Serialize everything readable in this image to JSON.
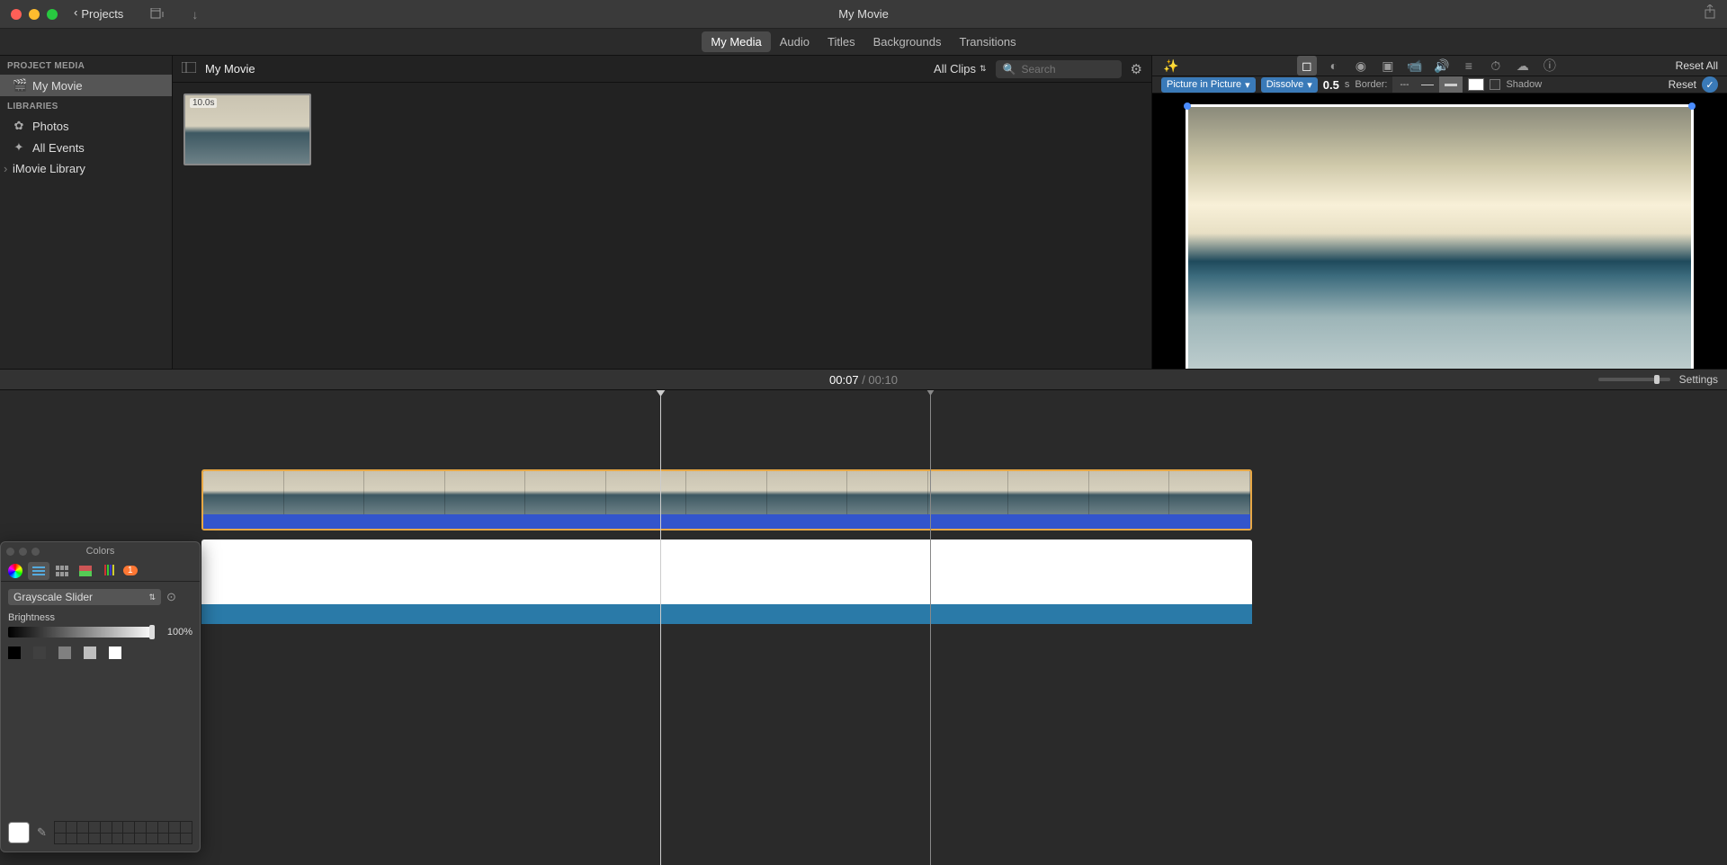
{
  "titlebar": {
    "back_label": "Projects",
    "title": "My Movie"
  },
  "tabs": {
    "my_media": "My Media",
    "audio": "Audio",
    "titles": "Titles",
    "backgrounds": "Backgrounds",
    "transitions": "Transitions"
  },
  "sidebar": {
    "project_media_header": "PROJECT MEDIA",
    "my_movie": "My Movie",
    "libraries_header": "LIBRARIES",
    "photos": "Photos",
    "all_events": "All Events",
    "imovie_library": "iMovie Library"
  },
  "browser": {
    "title": "My Movie",
    "clips_filter": "All Clips",
    "search_placeholder": "Search",
    "clip_duration": "10.0s"
  },
  "viewer": {
    "reset_all": "Reset All",
    "overlay_mode": "Picture in Picture",
    "transition_mode": "Dissolve",
    "duration_value": "0.5",
    "duration_unit": "s",
    "border_label": "Border:",
    "border_none": "---",
    "shadow_label": "Shadow",
    "reset": "Reset"
  },
  "timeline": {
    "current_time": "00:07",
    "separator": " / ",
    "total_time": "00:10",
    "settings_label": "Settings"
  },
  "colors_panel": {
    "title": "Colors",
    "badge": "1",
    "slider_type": "Grayscale Slider",
    "brightness_label": "Brightness",
    "brightness_value": "100%",
    "grey_swatches": [
      "#000000",
      "#404040",
      "#808080",
      "#bfbfbf",
      "#ffffff"
    ]
  }
}
